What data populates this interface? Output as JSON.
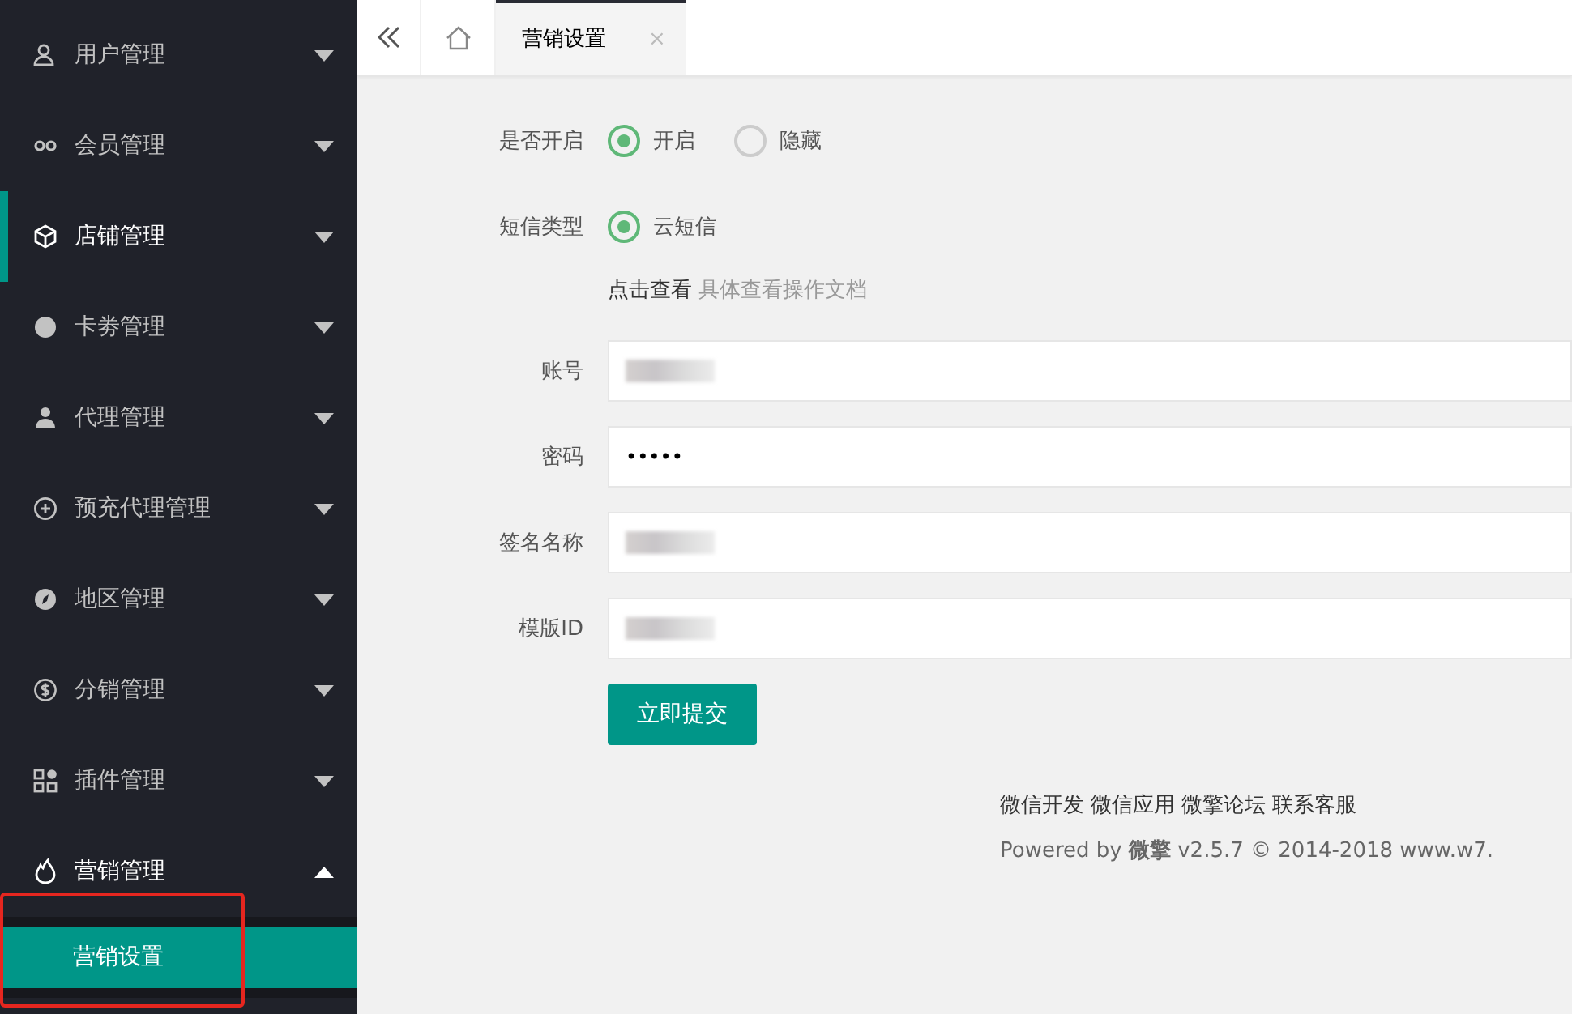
{
  "sidebar": {
    "items": [
      {
        "label": "用户管理",
        "active": false,
        "expanded": false
      },
      {
        "label": "会员管理",
        "active": false,
        "expanded": false
      },
      {
        "label": "店铺管理",
        "active": true,
        "expanded": false
      },
      {
        "label": "卡劵管理",
        "active": false,
        "expanded": false
      },
      {
        "label": "代理管理",
        "active": false,
        "expanded": false
      },
      {
        "label": "预充代理管理",
        "active": false,
        "expanded": false
      },
      {
        "label": "地区管理",
        "active": false,
        "expanded": false
      },
      {
        "label": "分销管理",
        "active": false,
        "expanded": false
      },
      {
        "label": "插件管理",
        "active": false,
        "expanded": false
      },
      {
        "label": "营销管理",
        "active": false,
        "expanded": true,
        "children": [
          {
            "label": "营销设置",
            "selected": true
          }
        ]
      }
    ]
  },
  "tabs": [
    {
      "label": "营销设置",
      "selected": true,
      "close": "×"
    }
  ],
  "form": {
    "switch": {
      "label": "是否开启",
      "options": [
        {
          "label": "开启",
          "selected": true
        },
        {
          "label": "隐藏",
          "selected": false
        }
      ]
    },
    "sms_type": {
      "label": "短信类型",
      "options": [
        {
          "label": "云短信",
          "selected": true
        }
      ]
    },
    "doc_hint": {
      "prefix": "点击查看",
      "link": "具体查看操作文档"
    },
    "fields": [
      {
        "label": "账号",
        "kind": "redacted"
      },
      {
        "label": "密码",
        "kind": "password",
        "value": "•••••"
      },
      {
        "label": "签名名称",
        "kind": "redacted"
      },
      {
        "label": "模版ID",
        "kind": "redacted"
      }
    ],
    "submit": "立即提交"
  },
  "footer": {
    "links": [
      "微信开发",
      "微信应用",
      "微擎论坛",
      "联系客服"
    ],
    "powered": "Powered by **微擎** v2.5.7 © 2014-2018 www.w7."
  }
}
